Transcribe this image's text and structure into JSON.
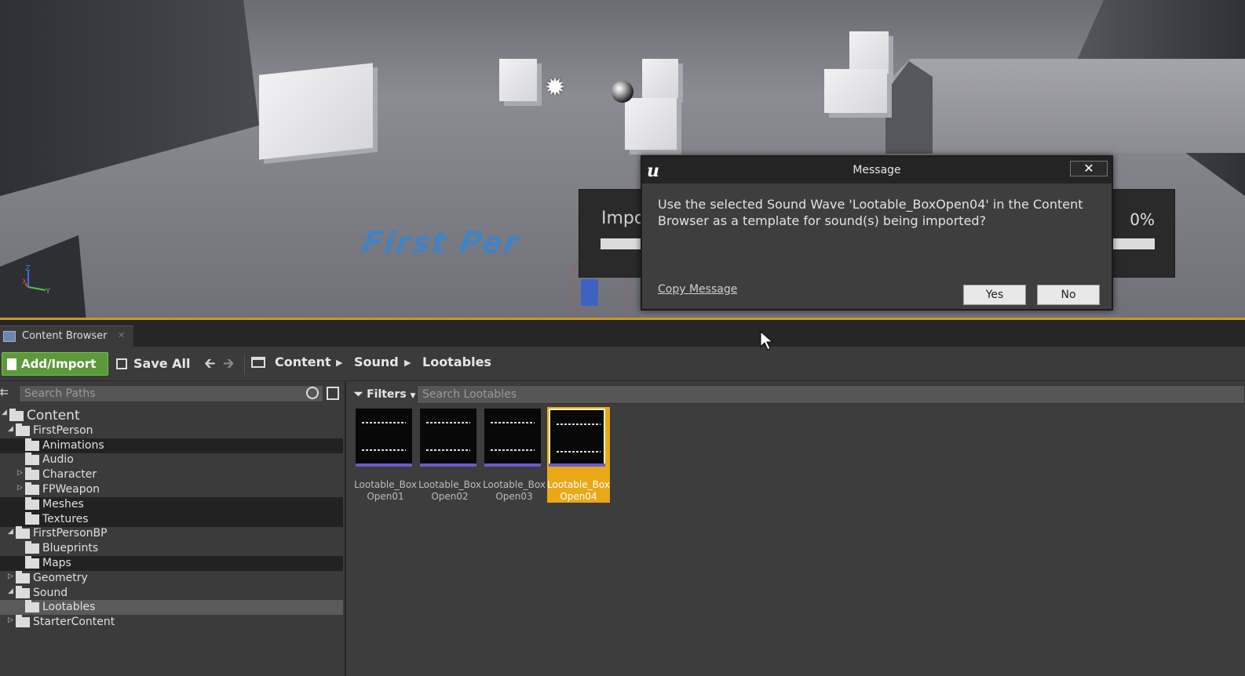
{
  "viewport": {
    "floor_text": "First Per",
    "axis_labels": {
      "z": "Z",
      "x": "X",
      "y": "Y"
    }
  },
  "progress_dialog": {
    "title": "Impo",
    "percent": "0%"
  },
  "message_dialog": {
    "title": "Message",
    "close_symbol": "✕",
    "body": "Use the selected Sound Wave 'Lootable_BoxOpen04' in the Content Browser as a template for sound(s) being imported?",
    "copy_message": "Copy Message",
    "yes_label": "Yes",
    "no_label": "No"
  },
  "content_browser": {
    "tab_label": "Content Browser",
    "toolbar": {
      "add_import_label": "Add/Import",
      "save_all_label": "Save All",
      "back_symbol": "🡰",
      "forward_symbol": "🡲",
      "breadcrumbs": [
        "Content",
        "Sound",
        "Lootables"
      ]
    },
    "search_paths_placeholder": "Search Paths",
    "filters_label": "Filters",
    "search_assets_placeholder": "Search Lootables",
    "tree": [
      {
        "label": "Content",
        "level": 0,
        "arrow": "◢",
        "style": "root"
      },
      {
        "label": "FirstPerson",
        "level": 1,
        "arrow": "◢"
      },
      {
        "label": "Animations",
        "level": 2,
        "arrow": "",
        "style": "dark"
      },
      {
        "label": "Audio",
        "level": 2,
        "arrow": ""
      },
      {
        "label": "Character",
        "level": 2,
        "arrow": "▷"
      },
      {
        "label": "FPWeapon",
        "level": 2,
        "arrow": "▷"
      },
      {
        "label": "Meshes",
        "level": 2,
        "arrow": "",
        "style": "dark"
      },
      {
        "label": "Textures",
        "level": 2,
        "arrow": "",
        "style": "dark"
      },
      {
        "label": "FirstPersonBP",
        "level": 1,
        "arrow": "◢"
      },
      {
        "label": "Blueprints",
        "level": 2,
        "arrow": ""
      },
      {
        "label": "Maps",
        "level": 2,
        "arrow": "",
        "style": "dark"
      },
      {
        "label": "Geometry",
        "level": 1,
        "arrow": "▷"
      },
      {
        "label": "Sound",
        "level": 1,
        "arrow": "◢"
      },
      {
        "label": "Lootables",
        "level": 2,
        "arrow": "",
        "style": "selected"
      },
      {
        "label": "StarterContent",
        "level": 1,
        "arrow": "▷"
      }
    ],
    "assets": [
      {
        "name_line1": "Lootable_Box",
        "name_line2": "Open01",
        "selected": false
      },
      {
        "name_line1": "Lootable_Box",
        "name_line2": "Open02",
        "selected": false
      },
      {
        "name_line1": "Lootable_Box",
        "name_line2": "Open03",
        "selected": false
      },
      {
        "name_line1": "Lootable_Box",
        "name_line2": "Open04",
        "selected": true
      }
    ]
  },
  "colors": {
    "accent_orange": "#e8a818",
    "add_import_green": "#5b9a3a",
    "sound_wave_bar": "#6a5acd"
  }
}
